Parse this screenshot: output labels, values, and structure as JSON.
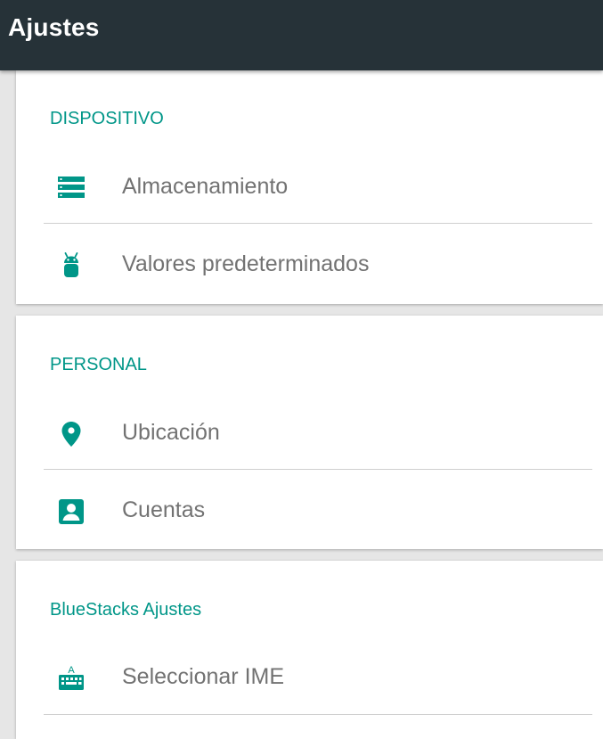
{
  "app_bar": {
    "title": "Ajustes"
  },
  "colors": {
    "accent": "#009688",
    "app_bar": "#263238",
    "text_secondary": "#727272"
  },
  "sections": [
    {
      "header": "DISPOSITIVO",
      "items": [
        {
          "label": "Almacenamiento",
          "icon": "storage-icon"
        },
        {
          "label": "Valores predeterminados",
          "icon": "android-icon"
        }
      ]
    },
    {
      "header": "PERSONAL",
      "items": [
        {
          "label": "Ubicación",
          "icon": "location-pin-icon"
        },
        {
          "label": "Cuentas",
          "icon": "account-box-icon"
        }
      ]
    },
    {
      "header": "BlueStacks Ajustes",
      "items": [
        {
          "label": "Seleccionar IME",
          "icon": "keyboard-icon"
        }
      ]
    }
  ]
}
